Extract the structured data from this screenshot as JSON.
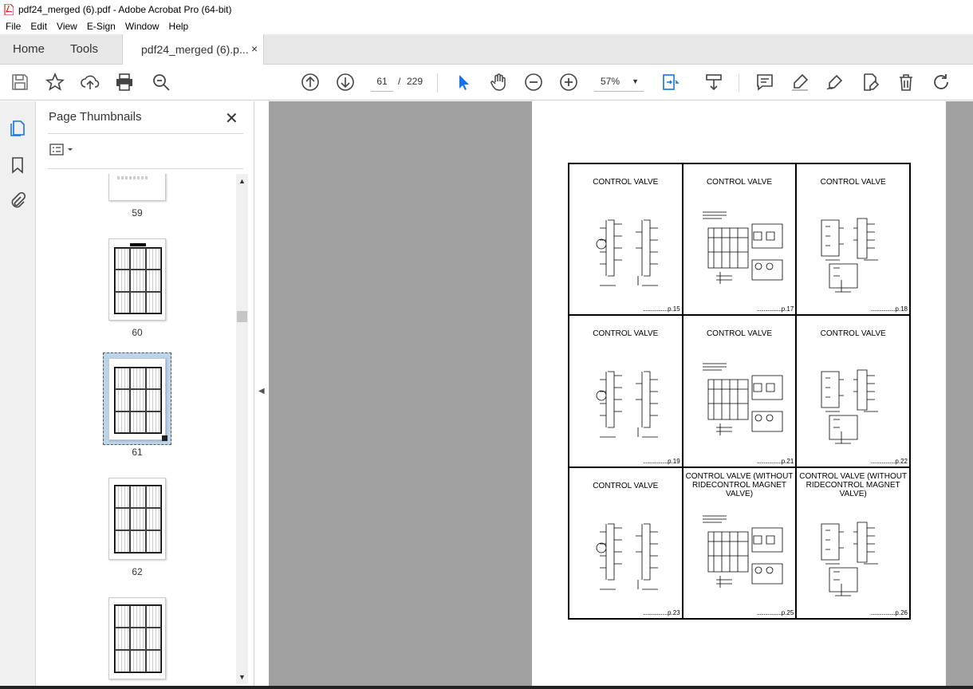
{
  "window": {
    "title": "pdf24_merged (6).pdf - Adobe Acrobat Pro (64-bit)"
  },
  "menu": [
    "File",
    "Edit",
    "View",
    "E-Sign",
    "Window",
    "Help"
  ],
  "tabs": {
    "home": "Home",
    "tools": "Tools",
    "document": "pdf24_merged (6).p...",
    "close": "×"
  },
  "toolbar": {
    "current_page": "61",
    "page_separator": "/",
    "total_pages": "229",
    "zoom": "57%",
    "icons": [
      "save-icon",
      "star-icon",
      "upload-icon",
      "print-icon",
      "zoom-search-icon",
      "page-up-icon",
      "page-down-icon",
      "select-arrow-icon",
      "hand-icon",
      "zoom-out-icon",
      "zoom-in-icon",
      "fit-page-icon",
      "scroll-mode-icon",
      "comment-icon",
      "highlight-icon",
      "sign-icon",
      "edit-pdf-icon",
      "delete-icon",
      "rotate-icon"
    ]
  },
  "panel": {
    "title": "Page Thumbnails",
    "close": "✕",
    "thumbnails": [
      {
        "label": "59"
      },
      {
        "label": "60"
      },
      {
        "label": "61",
        "selected": true
      },
      {
        "label": "62"
      },
      {
        "label": ""
      }
    ]
  },
  "document": {
    "cells": [
      {
        "title": "CONTROL VALVE",
        "page_ref": "p.15"
      },
      {
        "title": "CONTROL VALVE",
        "page_ref": "p.17"
      },
      {
        "title": "CONTROL VALVE",
        "page_ref": "p.18"
      },
      {
        "title": "CONTROL VALVE",
        "page_ref": "p.19"
      },
      {
        "title": "CONTROL VALVE",
        "page_ref": "p.21"
      },
      {
        "title": "CONTROL VALVE",
        "page_ref": "p.22"
      },
      {
        "title": "CONTROL VALVE",
        "page_ref": "p.23"
      },
      {
        "title": "CONTROL VALVE (WITHOUT RIDECONTROL MAGNET VALVE)",
        "page_ref": "p.25"
      },
      {
        "title": "CONTROL VALVE (WITHOUT RIDECONTROL MAGNET VALVE)",
        "page_ref": "p.26"
      }
    ]
  },
  "colors": {
    "accent": "#1473e6",
    "doc_bg": "#a0a0a0",
    "selection": "#bcd4ea"
  }
}
